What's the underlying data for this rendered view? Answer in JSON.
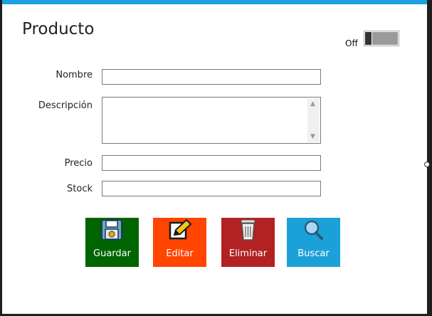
{
  "form": {
    "title": "Producto",
    "toggle_label": "Off",
    "fields": {
      "nombre_label": "Nombre",
      "descripcion_label": "Descripción",
      "precio_label": "Precio",
      "stock_label": "Stock",
      "nombre_value": "",
      "precio_value": "",
      "stock_value": ""
    },
    "buttons": {
      "guardar": "Guardar",
      "editar": "Editar",
      "eliminar": "Eliminar",
      "buscar": "Buscar"
    }
  },
  "colors": {
    "accent_bar": "#1ba1e2",
    "guardar": "#006400",
    "editar": "#ff4500",
    "eliminar": "#b22222",
    "buscar": "#1ba1d8"
  },
  "icons": {
    "guardar": "floppy-disk-icon",
    "editar": "pencil-edit-icon",
    "eliminar": "trash-icon",
    "buscar": "magnifier-icon"
  }
}
